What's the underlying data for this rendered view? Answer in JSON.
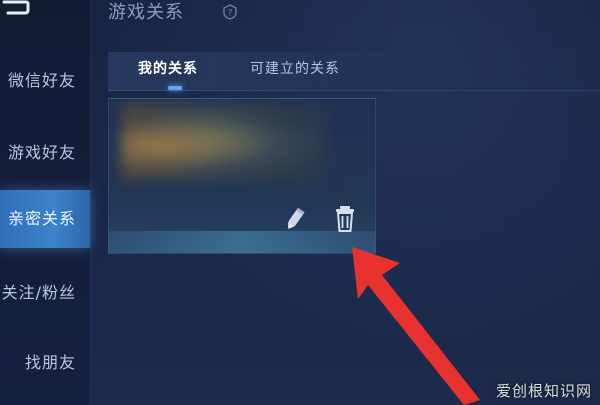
{
  "header": {
    "title": "游戏关系",
    "help_icon": "question-icon"
  },
  "sidebar": {
    "back_icon": "back-icon",
    "items": [
      {
        "label": "微信好友",
        "active": false
      },
      {
        "label": "游戏好友",
        "active": false
      },
      {
        "label": "亲密关系",
        "active": true
      },
      {
        "label": "关注/粉丝",
        "active": false
      },
      {
        "label": "找朋友",
        "active": false
      }
    ]
  },
  "tabs": [
    {
      "label": "我的关系",
      "active": true
    },
    {
      "label": "可建立的关系",
      "active": false
    }
  ],
  "card": {
    "actions": [
      {
        "name": "edit",
        "icon": "pencil-icon"
      },
      {
        "name": "delete",
        "icon": "trash-icon"
      }
    ]
  },
  "annotation": {
    "arrow_color": "#e8322f"
  },
  "watermark": {
    "text": "爱创根知识网"
  },
  "colors": {
    "accent": "#3b84cc",
    "background": "#1a2747"
  }
}
